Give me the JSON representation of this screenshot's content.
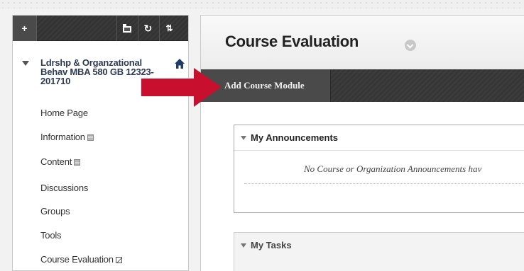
{
  "course_menu": {
    "toolbar": {
      "add_symbol": "+",
      "refresh_symbol": "↻",
      "sort_symbol": "⇅"
    },
    "course_title": "Ldrshp & Organzational Behav MBA 580 GB 12323-201710",
    "items": [
      {
        "label": "Home Page"
      },
      {
        "label": "Information"
      },
      {
        "label": "Content"
      },
      {
        "label": "Discussions"
      },
      {
        "label": "Groups"
      },
      {
        "label": "Tools"
      },
      {
        "label": "Course Evaluation"
      }
    ]
  },
  "main": {
    "page_title": "Course Evaluation",
    "action_bar": {
      "add_module_label": "Add Course Module"
    },
    "modules": {
      "announcements": {
        "title": "My Announcements",
        "empty_text": "No Course or Organization Announcements hav"
      },
      "tasks": {
        "title": "My Tasks"
      }
    }
  },
  "colors": {
    "pointer_arrow": "#c8102e",
    "course_title_text": "#2d3a52",
    "toolbar_dark": "#3a3a3a"
  },
  "icons": {
    "home": "home-icon",
    "folder": "folder-icon",
    "refresh": "refresh-icon",
    "sort": "sort-icon",
    "collapse": "chevron-down-icon"
  }
}
